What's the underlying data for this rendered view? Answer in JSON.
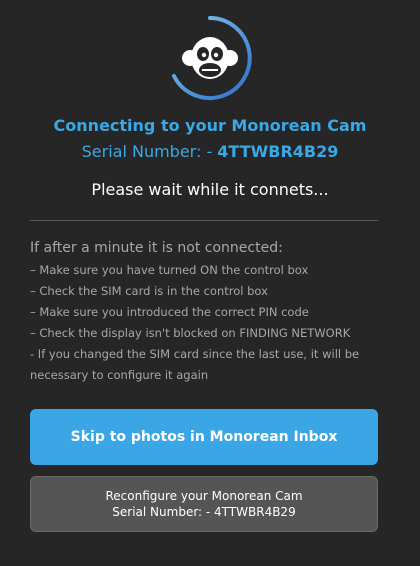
{
  "header": {
    "logo_icon": "monkey-logo-icon",
    "spinner_icon": "loading-spinner-icon",
    "title": "Connecting to your Monorean Cam",
    "serial_label": "Serial Number: - ",
    "serial_value": "4TTWBR4B29",
    "wait_text": "Please wait while it connets..."
  },
  "help": {
    "heading": "If after a minute it is not connected:",
    "lines": [
      "– Make sure you have turned ON the control box",
      "– Check the SIM card is in the control box",
      "– Make sure you introduced the correct PIN code",
      "– Check the display isn't blocked on FINDING NETWORK",
      "- If you changed the SIM card since the last use, it will be necessary to configure it again"
    ]
  },
  "buttons": {
    "skip_label": "Skip to photos in Monorean Inbox",
    "reconfigure_label": "Reconfigure your Monorean Cam",
    "reconfigure_serial": "Serial Number: - 4TTWBR4B29"
  },
  "colors": {
    "accent": "#3ba8e6",
    "background": "#262626",
    "secondary_button": "#555555"
  }
}
